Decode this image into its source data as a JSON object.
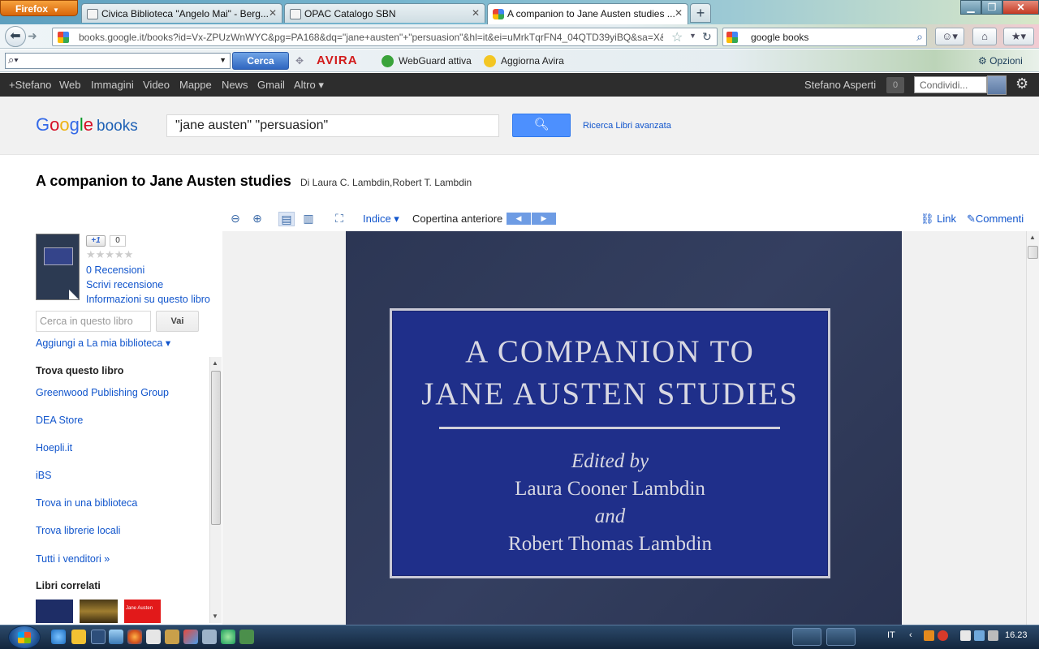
{
  "browser": {
    "app_button": "Firefox",
    "tabs": [
      {
        "title": "Civica Biblioteca \"Angelo Mai\" - Berg..."
      },
      {
        "title": "OPAC Catalogo SBN"
      },
      {
        "title": "A companion to Jane Austen studies ..."
      }
    ],
    "url": "books.google.it/books?id=Vx-ZPUzWnWYC&pg=PA168&dq=\"jane+austen\"+\"persuasion\"&hl=it&ei=uMrkTqrFN4_04QTD39yiBQ&sa=X&",
    "search_engine_text": "google books",
    "options_label": "Opzioni"
  },
  "addon_toolbar": {
    "search_button": "Cerca",
    "avira_logo": "AVIRA",
    "webguard": "WebGuard attiva",
    "update": "Aggiorna Avira"
  },
  "google_bar": {
    "links": [
      "+Stefano",
      "Web",
      "Immagini",
      "Video",
      "Mappe",
      "News",
      "Gmail",
      "Altro ▾"
    ],
    "user": "Stefano Asperti",
    "notifications": "0",
    "share_placeholder": "Condividi..."
  },
  "books_header": {
    "logo_google": "Google",
    "logo_books": "books",
    "query": "\"jane austen\" \"persuasion\"",
    "advanced": "Ricerca Libri avanzata"
  },
  "book": {
    "title": "A companion to Jane Austen studies",
    "authors": "Di Laura C. Lambdin,Robert T. Lambdin",
    "plus_one": "+1",
    "plus_count": "0",
    "reviews": "0 Recensioni",
    "write_review": "Scrivi recensione",
    "info": "Informazioni su questo libro",
    "in_book_search_placeholder": "Cerca in questo libro",
    "go_button": "Vai",
    "add_to_library": "Aggiungi a La mia biblioteca ▾",
    "find_heading": "Trova questo libro",
    "sellers": [
      "Greenwood Publishing Group",
      "DEA Store",
      "Hoepli.it",
      "iBS",
      "Trova in una biblioteca",
      "Trova librerie locali",
      "Tutti i venditori »"
    ],
    "related_heading": "Libri correlati",
    "related_thumb_3": "Jane Austen"
  },
  "viewer_toolbar": {
    "index": "Indice ▾",
    "cover": "Copertina anteriore",
    "link": "Link",
    "comments": "Commenti"
  },
  "cover": {
    "line1": "A COMPANION TO",
    "line2": "JANE AUSTEN STUDIES",
    "edited_by": "Edited by",
    "editor1": "Laura Cooner Lambdin",
    "and": "and",
    "editor2": "Robert Thomas Lambdin"
  },
  "taskbar": {
    "language": "IT",
    "clock": "16.23"
  }
}
